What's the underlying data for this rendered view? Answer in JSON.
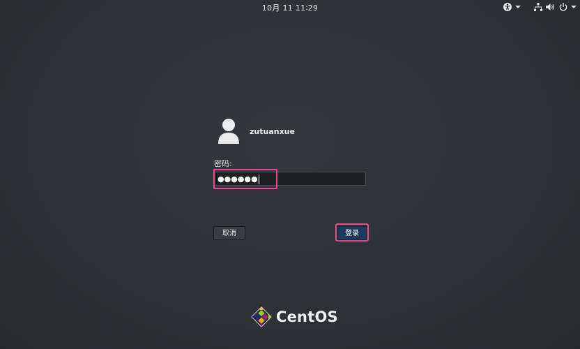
{
  "topbar": {
    "clock": "10月 11  11∶29",
    "icons": [
      "accessibility-icon",
      "network-icon",
      "volume-icon",
      "power-icon"
    ]
  },
  "login": {
    "username": "zutuanxue",
    "password_label": "密码:",
    "password_mask": "●●●●●●",
    "cancel_label": "取消",
    "login_label": "登录"
  },
  "branding": {
    "logo_text": "CentOS"
  },
  "colors": {
    "background": "#2f3236",
    "highlight": "#e44a8f",
    "login_button": "#20395a"
  }
}
